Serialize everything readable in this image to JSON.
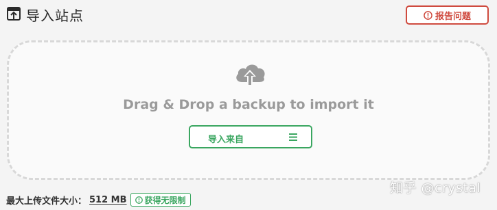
{
  "header": {
    "title": "导入站点",
    "title_icon": "upload-box-icon",
    "report_button_label": "报告问题",
    "report_icon": "alert-circle-icon"
  },
  "dropzone": {
    "icon": "cloud-upload-icon",
    "text": "Drag & Drop a backup to import it",
    "import_button_label": "导入来自",
    "menu_icon": "hamburger-menu-icon"
  },
  "footer": {
    "max_upload_label": "最大上传文件大小：",
    "max_upload_value": "512 MB",
    "unlimited_badge_label": "获得无限制",
    "badge_icon": "alert-circle-icon"
  },
  "watermark": "知乎 @crystal",
  "colors": {
    "danger": "#cf4a3e",
    "success": "#3aa660",
    "muted_text": "#9a9a9a",
    "dashed_border": "#d8d8d8"
  }
}
